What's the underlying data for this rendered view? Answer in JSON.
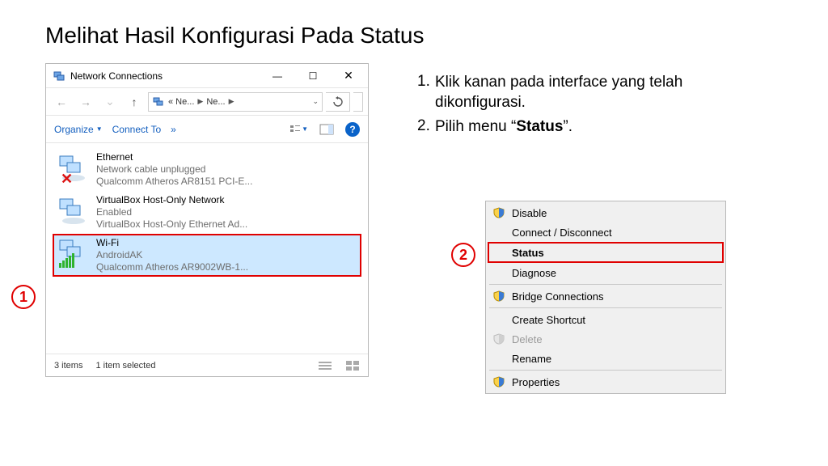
{
  "slide_title": "Melihat Hasil Konfigurasi Pada Status",
  "window": {
    "title": "Network Connections",
    "address": {
      "crumb1": "« Ne...",
      "crumb2": "Ne..."
    },
    "toolbar": {
      "organize": "Organize",
      "connect_to": "Connect To",
      "overflow": "»"
    },
    "connections": [
      {
        "name": "Ethernet",
        "status": "Network cable unplugged",
        "adapter": "Qualcomm Atheros AR8151 PCI-E..."
      },
      {
        "name": "VirtualBox Host-Only Network",
        "status": "Enabled",
        "adapter": "VirtualBox Host-Only Ethernet Ad..."
      },
      {
        "name": "Wi-Fi",
        "status": "AndroidAK",
        "adapter": "Qualcomm Atheros AR9002WB-1..."
      }
    ],
    "statusbar": {
      "items": "3 items",
      "selected": "1 item selected"
    }
  },
  "steps": [
    {
      "num": "1.",
      "text_before": "Klik kanan pada interface yang telah dikonfigurasi.",
      "bold": "",
      "text_after": ""
    },
    {
      "num": "2.",
      "text_before": "Pilih menu “",
      "bold": "Status",
      "text_after": "”."
    }
  ],
  "callouts": {
    "one": "1",
    "two": "2"
  },
  "context_menu": {
    "disable": "Disable",
    "connect": "Connect / Disconnect",
    "status": "Status",
    "diagnose": "Diagnose",
    "bridge": "Bridge Connections",
    "shortcut": "Create Shortcut",
    "delete": "Delete",
    "rename": "Rename",
    "properties": "Properties"
  }
}
